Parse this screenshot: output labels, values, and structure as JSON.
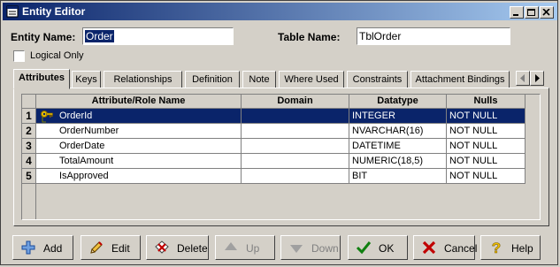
{
  "window": {
    "title": "Entity Editor"
  },
  "form": {
    "entity_name_label": "Entity Name:",
    "entity_name_value": "Order",
    "table_name_label": "Table Name:",
    "table_name_value": "TblOrder",
    "logical_only_label": "Logical Only",
    "logical_only_checked": false
  },
  "tabs": [
    {
      "label": "Attributes",
      "active": true
    },
    {
      "label": "Keys"
    },
    {
      "label": "Relationships"
    },
    {
      "label": "Definition"
    },
    {
      "label": "Note"
    },
    {
      "label": "Where Used"
    },
    {
      "label": "Constraints"
    },
    {
      "label": "Attachment Bindings"
    }
  ],
  "grid": {
    "columns": [
      "Attribute/Role Name",
      "Domain",
      "Datatype",
      "Nulls"
    ],
    "rows": [
      {
        "num": "1",
        "name": "OrderId",
        "domain": "",
        "datatype": "INTEGER",
        "nulls": "NOT NULL",
        "selected": true,
        "key": true
      },
      {
        "num": "2",
        "name": "OrderNumber",
        "domain": "",
        "datatype": "NVARCHAR(16)",
        "nulls": "NOT NULL"
      },
      {
        "num": "3",
        "name": "OrderDate",
        "domain": "",
        "datatype": "DATETIME",
        "nulls": "NOT NULL"
      },
      {
        "num": "4",
        "name": "TotalAmount",
        "domain": "",
        "datatype": "NUMERIC(18,5)",
        "nulls": "NOT NULL"
      },
      {
        "num": "5",
        "name": "IsApproved",
        "domain": "",
        "datatype": "BIT",
        "nulls": "NOT NULL"
      }
    ]
  },
  "buttons": {
    "add": "Add",
    "edit": "Edit",
    "delete": "Delete",
    "up": "Up",
    "down": "Down",
    "ok": "OK",
    "cancel": "Cancel",
    "help": "Help"
  },
  "colors": {
    "title_start": "#0a246a",
    "title_end": "#a6caf0",
    "selection": "#0a246a",
    "face": "#d4d0c8"
  }
}
